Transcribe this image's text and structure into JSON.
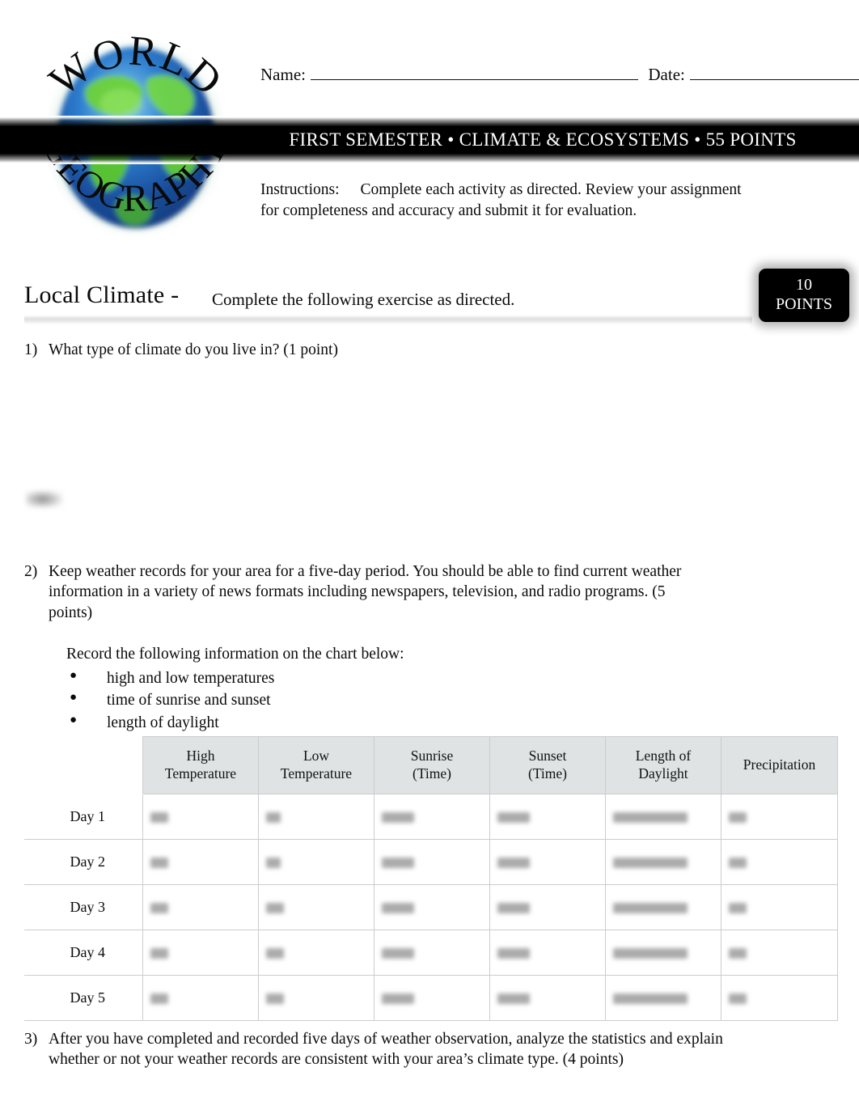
{
  "header": {
    "logo": {
      "top_text": "WORLD",
      "bottom_text": "GEOGRAPHY",
      "globe_ocean_color": "#1f63b5",
      "globe_land_color": "#55c22d"
    },
    "name_label": "Name:",
    "date_label": "Date:",
    "name_value": "",
    "date_value": "",
    "banner_text": "FIRST SEMESTER •   CLIMATE & ECOSYSTEMS •  55 POINTS",
    "banner_color": "#000000",
    "instructions_label": "Instructions:",
    "instructions_text": "Complete each activity as directed. Review your assignment for completeness and accuracy and submit it for evaluation."
  },
  "section": {
    "title": "Local Climate -",
    "subtitle": "Complete the following exercise as directed.",
    "points_value": "10",
    "points_label": "POINTS",
    "points_badge_color": "#000000"
  },
  "questions": {
    "q1": {
      "number": "1)",
      "text": "What type of climate do you live in? (1 point)",
      "answer": ""
    },
    "q2": {
      "number": "2)",
      "text": "Keep weather records for your area for a five-day period. You should be able to find current weather information in a variety of news formats including newspapers, television, and radio programs. (5 points)",
      "record_intro": "Record the following information on the chart below:",
      "bullets": [
        "high and low temperatures",
        "time of sunrise and sunset",
        "length of daylight"
      ]
    },
    "q3": {
      "number": "3)",
      "text": "After you have completed and recorded five days of weather observation, analyze the statistics and explain whether or not your weather records are consistent with your area’s climate type. (4 points)",
      "answer": ""
    }
  },
  "table": {
    "corner_label": "",
    "headers": [
      "High\nTemperature",
      "Low\nTemperature",
      "Sunrise\n(Time)",
      "Sunset\n(Time)",
      "Length of\nDaylight",
      "Precipitation"
    ],
    "headers_line1": [
      "High",
      "Low",
      "Sunrise",
      "Sunset",
      "Length of",
      "Precipitation"
    ],
    "headers_line2": [
      "Temperature",
      "Temperature",
      "(Time)",
      "(Time)",
      "Daylight",
      ""
    ],
    "header_bg": "#dfe3e4",
    "rows": [
      {
        "label": "Day 1",
        "values": [
          "",
          "",
          "",
          "",
          "",
          ""
        ]
      },
      {
        "label": "Day 2",
        "values": [
          "",
          "",
          "",
          "",
          "",
          ""
        ]
      },
      {
        "label": "Day 3",
        "values": [
          "",
          "",
          "",
          "",
          "",
          ""
        ]
      },
      {
        "label": "Day 4",
        "values": [
          "",
          "",
          "",
          "",
          "",
          ""
        ]
      },
      {
        "label": "Day 5",
        "values": [
          "",
          "",
          "",
          "",
          "",
          ""
        ]
      }
    ],
    "values_obscured": true
  }
}
